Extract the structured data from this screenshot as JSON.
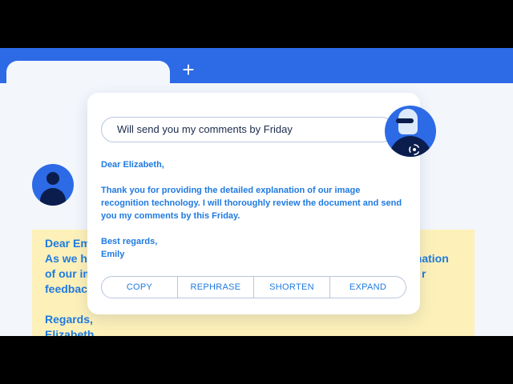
{
  "browser": {
    "new_tab_symbol": "+"
  },
  "assistant": {
    "prompt_value": "Will send you my comments by Friday",
    "reply": {
      "greeting": "Dear Elizabeth,",
      "body": "Thank you for providing the detailed explanation of our image recognition technology. I will thoroughly review the document and send you my comments by this Friday.",
      "closing": "Best regards,",
      "signature": "Emily"
    },
    "actions": [
      "COPY",
      "REPHRASE",
      "SHORTEN",
      "EXPAND"
    ]
  },
  "email_preview": {
    "lines_left": [
      "Dear Em",
      "As we ha",
      "of our im",
      "feedbac",
      "",
      "Regards,",
      "Elizabeth"
    ],
    "lines_right": [
      "anation",
      "r"
    ]
  },
  "colors": {
    "accent": "#2d6ae6",
    "text_blue": "#1f7ae0",
    "email_bg": "#fdf1b9"
  }
}
